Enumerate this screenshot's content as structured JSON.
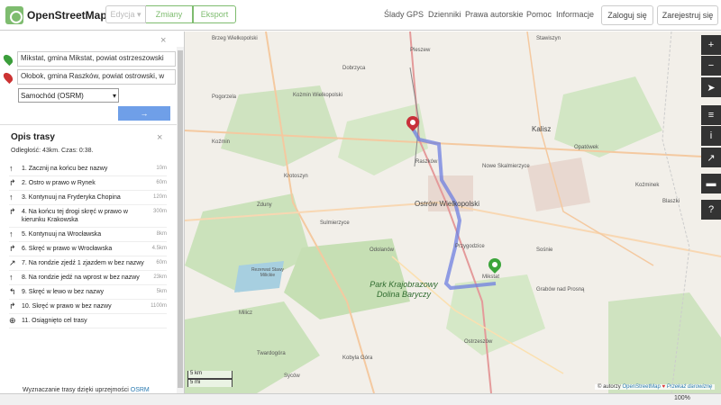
{
  "header": {
    "logo_text": "OpenStreetMap",
    "edit_label": "Edycja",
    "edit_caret": "▾",
    "history_label": "Zmiany",
    "export_label": "Eksport",
    "nav": [
      "Ślady GPS",
      "Dzienniki",
      "Prawa autorskie",
      "Pomoc",
      "Informacje"
    ],
    "login_label": "Zaloguj się",
    "signup_label": "Zarejestruj się"
  },
  "sidebar": {
    "close_glyph": "×",
    "from_value": "Mikstat, gmina Mikstat, powiat ostrzeszowski",
    "to_value": "Ołobok, gmina Raszków, powiat ostrowski, w",
    "engine_value": "Samochód (OSRM)",
    "engine_caret": "▾",
    "go_label": "→",
    "directions_title": "Opis trasy",
    "summary": "Odległość: 43km. Czas: 0:38.",
    "credit_text": "Wyznaczanie trasy dzięki uprzejmości",
    "credit_link": "OSRM"
  },
  "steps": [
    {
      "icon": "↑",
      "text": "1. Zacznij na końcu bez nazwy",
      "dist": "10m"
    },
    {
      "icon": "↱",
      "text": "2. Ostro w prawo w Rynek",
      "dist": "60m"
    },
    {
      "icon": "↑",
      "text": "3. Kontynuuj na Fryderyka Chopina",
      "dist": "120m"
    },
    {
      "icon": "↱",
      "text": "4. Na końcu tej drogi skręć w prawo w kierunku Krakowska",
      "dist": "300m"
    },
    {
      "icon": "↑",
      "text": "5. Kontynuuj na Wrocławska",
      "dist": "8km"
    },
    {
      "icon": "↱",
      "text": "6. Skręć w prawo w Wrocławska",
      "dist": "4.5km"
    },
    {
      "icon": "↗",
      "text": "7. Na rondzie zjedź 1 zjazdem w bez nazwy",
      "dist": "60m"
    },
    {
      "icon": "↑",
      "text": "8. Na rondzie jedź na wprost w bez nazwy",
      "dist": "23km"
    },
    {
      "icon": "↰",
      "text": "9. Skręć w lewo w bez nazwy",
      "dist": "5km"
    },
    {
      "icon": "↱",
      "text": "10. Skręć w prawo w bez nazwy",
      "dist": "1100m"
    },
    {
      "icon": "⊕",
      "text": "11. Osiągnięto cel trasy",
      "dist": ""
    }
  ],
  "map": {
    "labels": [
      {
        "text": "Brzeg Wielkopolski"
      },
      {
        "text": "Pleszew"
      },
      {
        "text": "Dobrzyca"
      },
      {
        "text": "Kożmin Wielkopolski"
      },
      {
        "text": "Pogorzela"
      },
      {
        "text": "Raszków"
      },
      {
        "text": "Kalisz"
      },
      {
        "text": "Opatówek"
      },
      {
        "text": "Nowe Skalmierzyce"
      },
      {
        "text": "Koźmin"
      },
      {
        "text": "Krotoszyn"
      },
      {
        "text": "Zduny"
      },
      {
        "text": "Ostrów Wielkopolski"
      },
      {
        "text": "Odolanów"
      },
      {
        "text": "Mikstat"
      },
      {
        "text": "Grabów nad Prosną"
      },
      {
        "text": "Ostrzeszów"
      },
      {
        "text": "Sulmierzyce"
      },
      {
        "text": "Milicz"
      },
      {
        "text": "Sośnie"
      },
      {
        "text": "Twardogóra"
      },
      {
        "text": "Syców"
      },
      {
        "text": "Kobyla Góra"
      },
      {
        "text": "Stawiszyn"
      },
      {
        "text": "Blaszki"
      },
      {
        "text": "Koźminek"
      },
      {
        "text": "Przygodzice"
      }
    ],
    "park_name": "Park Krajobrazowy Dolina Baryczy",
    "park2_name": "Rezerwat Stawy Milickie",
    "scale_km": "5 km",
    "scale_mi": "5 mi",
    "attribution_prefix": "© autorzy",
    "attribution_osm": "OpenStreetMap",
    "attribution_heart": "♥",
    "attribution_donate": "Przekaż darowiznę",
    "route_color": "#6e7fe0",
    "start_color": "#3ba53b",
    "end_color": "#c8303a"
  },
  "controls": [
    "+",
    "−",
    "➤",
    "≡",
    "i",
    "↗",
    "▬",
    "?"
  ],
  "status": {
    "zoom": "100%"
  }
}
